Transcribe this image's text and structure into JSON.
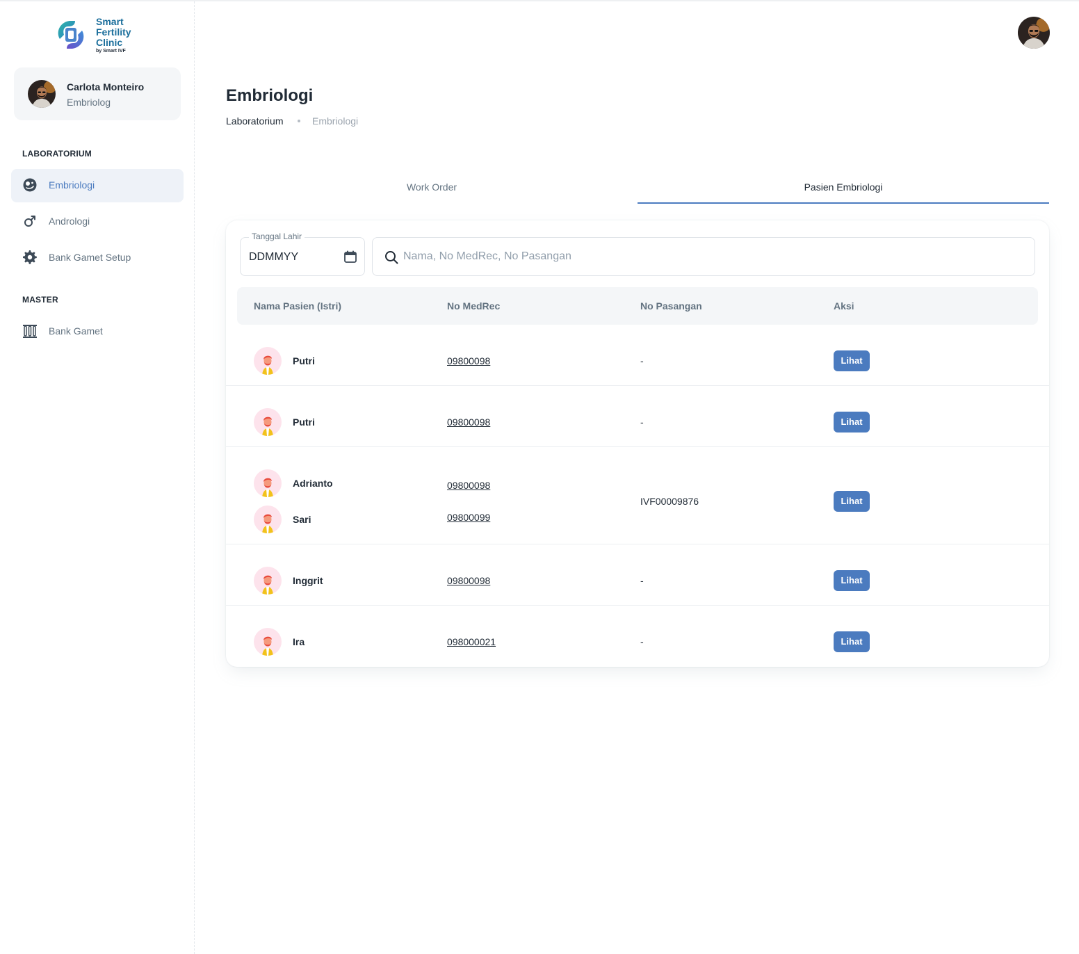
{
  "brand": {
    "name_line1": "Smart",
    "name_line2": "Fertility",
    "name_line3": "Clinic",
    "tagline": "by Smart IVF",
    "colors": {
      "accent": "#4b7bbf",
      "brand": "#1c6f9c"
    }
  },
  "user": {
    "name": "Carlota Monteiro",
    "role": "Embriolog"
  },
  "sidebar": {
    "sections": [
      {
        "title": "LABORATORIUM",
        "items": [
          {
            "label": "Embriologi",
            "icon": "embryo-icon",
            "active": true
          },
          {
            "label": "Andrologi",
            "icon": "male-icon",
            "active": false
          },
          {
            "label": "Bank Gamet Setup",
            "icon": "gear-icon",
            "active": false
          }
        ]
      },
      {
        "title": "MASTER",
        "items": [
          {
            "label": "Bank Gamet",
            "icon": "test-tubes-icon",
            "active": false
          }
        ]
      }
    ]
  },
  "header": {
    "title": "Embriologi",
    "breadcrumb": [
      "Laboratorium",
      "Embriologi"
    ]
  },
  "tabs": [
    {
      "label": "Work Order",
      "active": false
    },
    {
      "label": "Pasien Embriologi",
      "active": true
    }
  ],
  "filters": {
    "date_label": "Tanggal Lahir",
    "date_value": "DDMMYY",
    "search_placeholder": "Nama, No MedRec, No Pasangan",
    "search_value": ""
  },
  "table": {
    "columns": [
      "Nama Pasien (Istri)",
      "No MedRec",
      "No Pasangan",
      "Aksi"
    ],
    "rows": [
      {
        "names": [
          "Putri"
        ],
        "medrec": [
          "09800098"
        ],
        "pasangan": "-",
        "action": "Lihat"
      },
      {
        "names": [
          "Putri"
        ],
        "medrec": [
          "09800098"
        ],
        "pasangan": "-",
        "action": "Lihat"
      },
      {
        "names": [
          "Adrianto",
          "Sari"
        ],
        "medrec": [
          "09800098",
          "09800099"
        ],
        "pasangan": "IVF00009876",
        "action": "Lihat"
      },
      {
        "names": [
          "Inggrit"
        ],
        "medrec": [
          "09800098"
        ],
        "pasangan": "-",
        "action": "Lihat"
      },
      {
        "names": [
          "Ira"
        ],
        "medrec": [
          "098000021"
        ],
        "pasangan": "-",
        "action": "Lihat"
      }
    ]
  }
}
